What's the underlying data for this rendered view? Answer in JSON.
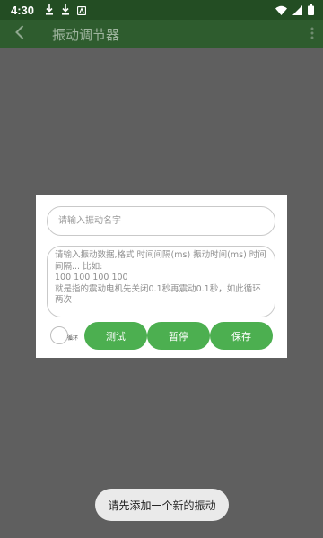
{
  "status_bar": {
    "time": "4:30",
    "left_icons": [
      "download-icon",
      "download-icon",
      "app-notification-icon"
    ],
    "right_icons": [
      "wifi-icon",
      "signal-icon",
      "battery-icon"
    ]
  },
  "app_bar": {
    "title": "振动调节器",
    "back_icon": "back-arrow-icon",
    "more_icon": "more-vert-icon"
  },
  "dialog": {
    "name_input": {
      "placeholder": "请输入振动名字",
      "value": ""
    },
    "data_input": {
      "placeholder": "请输入振动数据,格式 时间间隔(ms) 振动时间(ms) 时间间隔... 比如:\n100 100 100 100\n就是指的震动电机先关闭0.1秒再震动0.1秒，如此循环两次",
      "value": ""
    },
    "loop_toggle": {
      "label": "循环",
      "checked": false
    },
    "buttons": {
      "test": "测试",
      "pause": "暂停",
      "save": "保存"
    }
  },
  "toast": {
    "message": "请先添加一个新的振动"
  },
  "colors": {
    "status_bar": "#234d23",
    "app_bar": "#2e5c2e",
    "accent_green": "#4caf50",
    "overlay": "#5f5f5f"
  }
}
